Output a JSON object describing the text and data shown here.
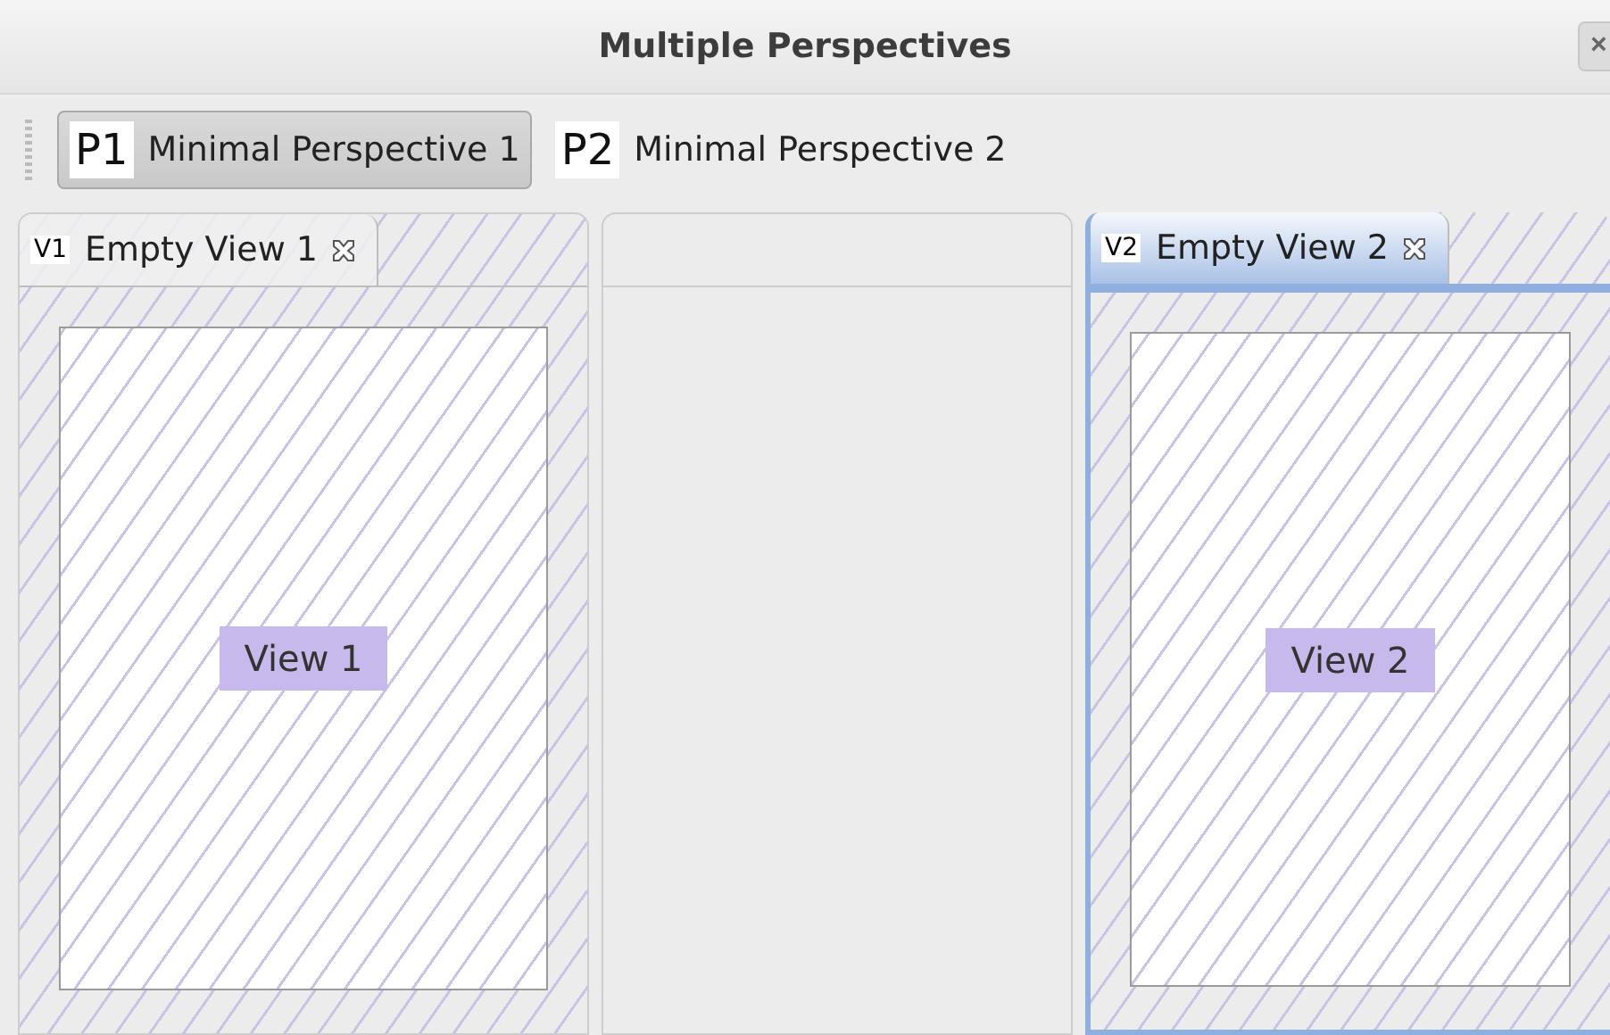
{
  "window": {
    "title": "Multiple Perspectives",
    "close": "×"
  },
  "perspectives": [
    {
      "icon": "P1",
      "label": "Minimal Perspective 1",
      "selected": true
    },
    {
      "icon": "P2",
      "label": "Minimal Perspective 2",
      "selected": false
    }
  ],
  "panels": [
    {
      "kind": "view",
      "tab_icon": "V1",
      "tab_label": "Empty View 1",
      "active": false,
      "content": "View 1"
    },
    {
      "kind": "empty"
    },
    {
      "kind": "view",
      "tab_icon": "V2",
      "tab_label": "Empty View 2",
      "active": true,
      "content": "View 2"
    }
  ]
}
